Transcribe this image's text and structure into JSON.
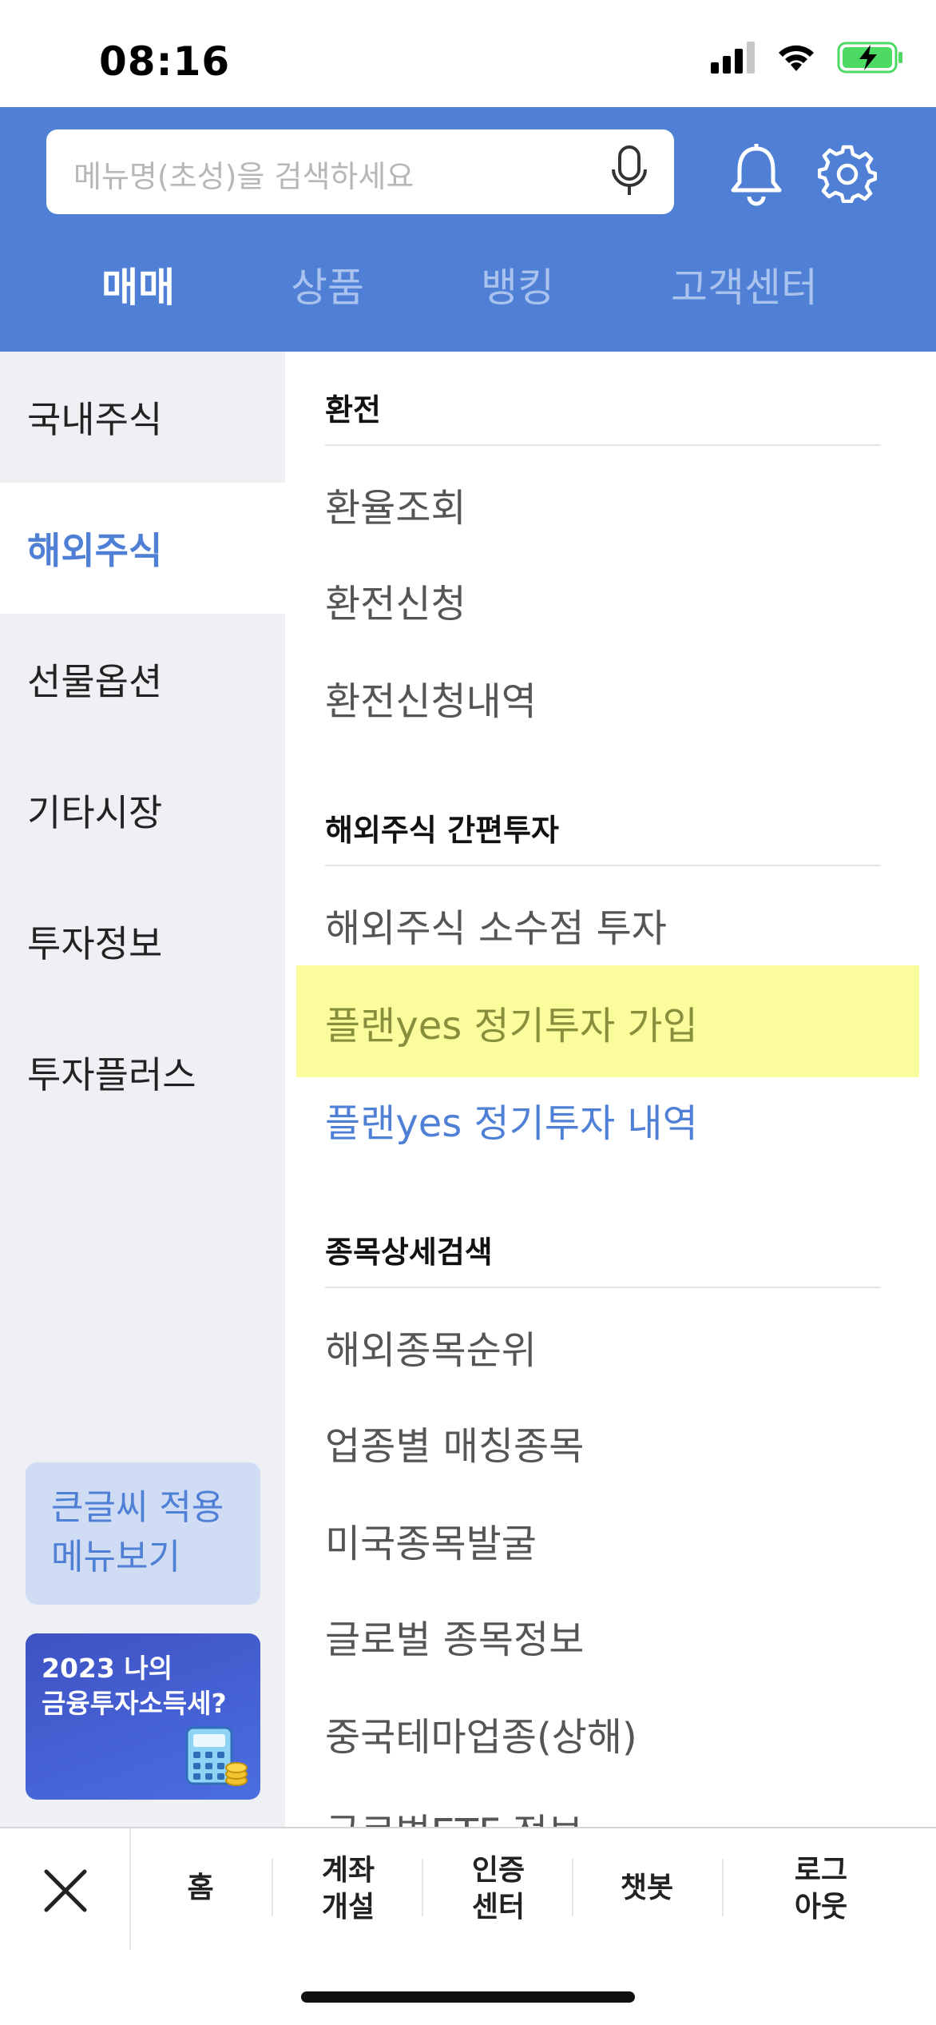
{
  "status_bar": {
    "time": "08:16"
  },
  "search": {
    "placeholder": "메뉴명(초성)을 검색하세요"
  },
  "tabs": [
    {
      "label": "매매",
      "active": true
    },
    {
      "label": "상품",
      "active": false
    },
    {
      "label": "뱅킹",
      "active": false
    },
    {
      "label": "고객센터",
      "active": false
    }
  ],
  "sidebar": {
    "items": [
      {
        "label": "국내주식"
      },
      {
        "label": "해외주식",
        "active": true
      },
      {
        "label": "선물옵션"
      },
      {
        "label": "기타시장"
      },
      {
        "label": "투자정보"
      },
      {
        "label": "투자플러스"
      }
    ],
    "bigfont_line1": "큰글씨 적용",
    "bigfont_line2": "메뉴보기",
    "banner_line1": "2023 나의",
    "banner_line2": "금융투자소득세?"
  },
  "content": {
    "sections": [
      {
        "title": "환전",
        "items": [
          "환율조회",
          "환전신청",
          "환전신청내역"
        ]
      },
      {
        "title": "해외주식 간편투자",
        "items": [
          "해외주식 소수점 투자",
          "플랜yes 정기투자 가입",
          "플랜yes 정기투자 내역"
        ]
      },
      {
        "title": "종목상세검색",
        "items": [
          "해외종목순위",
          "업종별 매칭종목",
          "미국종목발굴",
          "글로벌 종목정보",
          "중국테마업종(상해)",
          "글로벌ETF 정보"
        ]
      }
    ]
  },
  "bottom_nav": {
    "home": "홈",
    "account_line1": "계좌",
    "account_line2": "개설",
    "cert_line1": "인증",
    "cert_line2": "센터",
    "chatbot": "챗봇",
    "logout_line1": "로그",
    "logout_line2": "아웃"
  },
  "colors": {
    "brand_blue": "#4f80d6",
    "highlight_yellow": "#fbfc9c",
    "battery_green": "#4cd964"
  }
}
